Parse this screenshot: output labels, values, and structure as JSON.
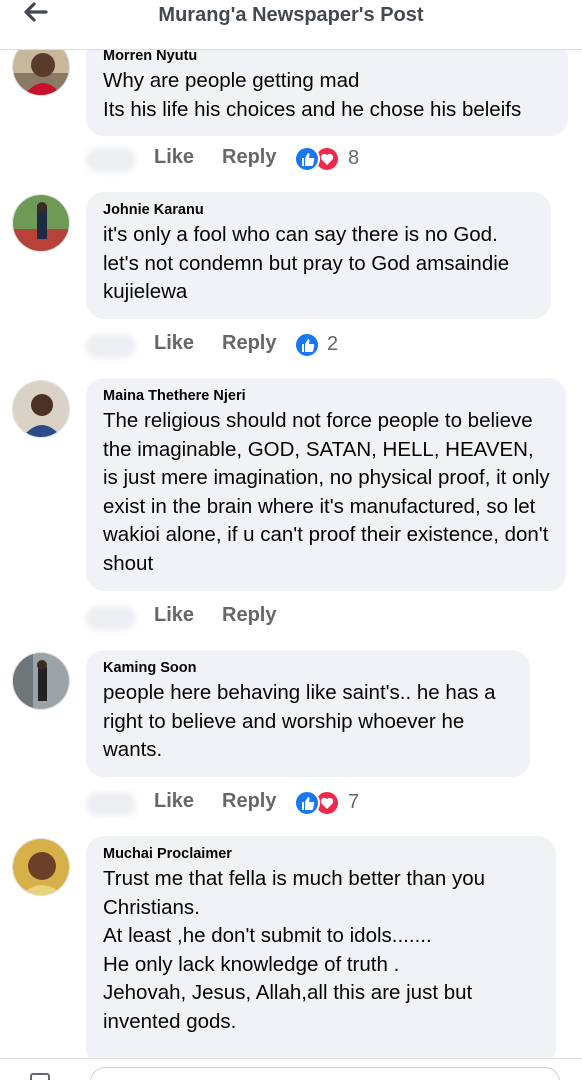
{
  "header": {
    "title": "Murang'a Newspaper's Post",
    "back_icon": "arrow-left-icon"
  },
  "actions": {
    "like_label": "Like",
    "reply_label": "Reply"
  },
  "colors": {
    "like_blue": "#1877f2",
    "love_red": "#f02849",
    "bubble_bg": "#f0f2f5",
    "muted_text": "#65676b"
  },
  "comments": [
    {
      "author": "Morren Nyutu",
      "text": "Why are people getting mad\nIts his life his choices and he chose his beleifs",
      "reactions": [
        "like",
        "love"
      ],
      "reaction_count": "8"
    },
    {
      "author": "Johnie Karanu",
      "text": "it's only a fool who can say there is no God.\nlet's not condemn but pray to God amsaindie kujielewa",
      "reactions": [
        "like"
      ],
      "reaction_count": "2"
    },
    {
      "author": "Maina Thethere Njeri",
      "text": "The religious should not force people to believe the imaginable, GOD, SATAN, HELL, HEAVEN, is just mere imagination, no physical proof, it only exist in the brain where it's manufactured, so let wakioi alone, if u can't proof their existence, don't shout",
      "reactions": [],
      "reaction_count": ""
    },
    {
      "author": "Kaming Soon",
      "text": "people here behaving like saint's.. he has a right to believe and worship whoever he wants.",
      "reactions": [
        "like",
        "love"
      ],
      "reaction_count": "7"
    },
    {
      "author": "Muchai Proclaimer",
      "text": "Trust me that fella is much better than you Christians.\nAt least ,he don't submit to idols.......\nHe only lack knowledge of truth .\nJehovah, Jesus, Allah,all this are just but invented gods.",
      "reactions": [],
      "reaction_count": ""
    }
  ]
}
